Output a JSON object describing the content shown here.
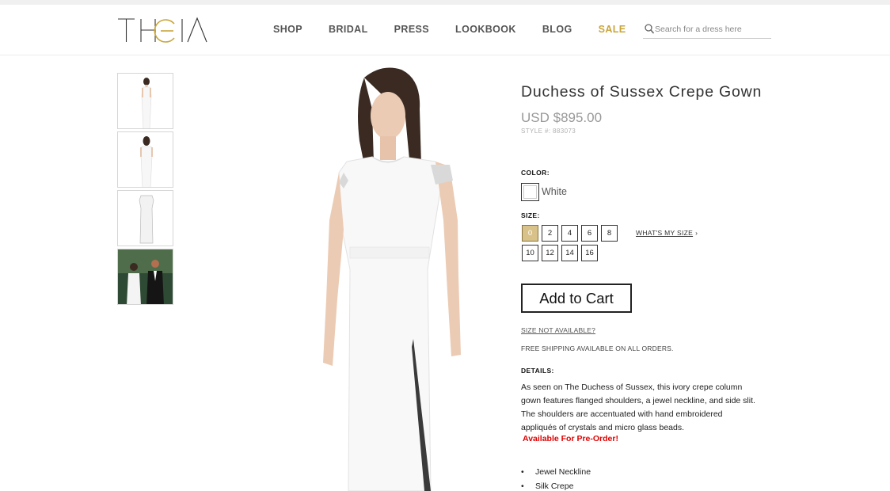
{
  "brand": {
    "logo_text": "THEIA"
  },
  "nav": {
    "items": [
      {
        "label": "SHOP"
      },
      {
        "label": "BRIDAL"
      },
      {
        "label": "PRESS"
      },
      {
        "label": "LOOKBOOK"
      },
      {
        "label": "BLOG"
      },
      {
        "label": "SALE"
      }
    ]
  },
  "search": {
    "placeholder": "Search for a dress here"
  },
  "product": {
    "title": "Duchess of Sussex Crepe Gown",
    "price": "USD $895.00",
    "style": "STYLE #: 883073",
    "color_label": "COLOR:",
    "color_value": "White",
    "size_label": "SIZE:",
    "sizes": [
      "0",
      "2",
      "4",
      "6",
      "8",
      "10",
      "12",
      "14",
      "16"
    ],
    "selected_size": "0",
    "whats_my_size": "WHAT'S MY SIZE",
    "add_to_cart": "Add to Cart",
    "size_not_available": "SIZE NOT AVAILABLE?",
    "shipping": "FREE SHIPPING AVAILABLE ON ALL ORDERS.",
    "details_label": "DETAILS:",
    "details": "As seen on The Duchess of Sussex, this ivory crepe column gown features flanged shoulders, a jewel neckline, and side slit. The shoulders are accentuated with hand embroidered appliqués of crystals and micro glass beads.",
    "preorder": "Available For Pre-Order!",
    "features": [
      "Jewel Neckline",
      "Silk Crepe"
    ]
  },
  "colors": {
    "accent_gold": "#c9a53a",
    "preorder_red": "#e00000"
  }
}
